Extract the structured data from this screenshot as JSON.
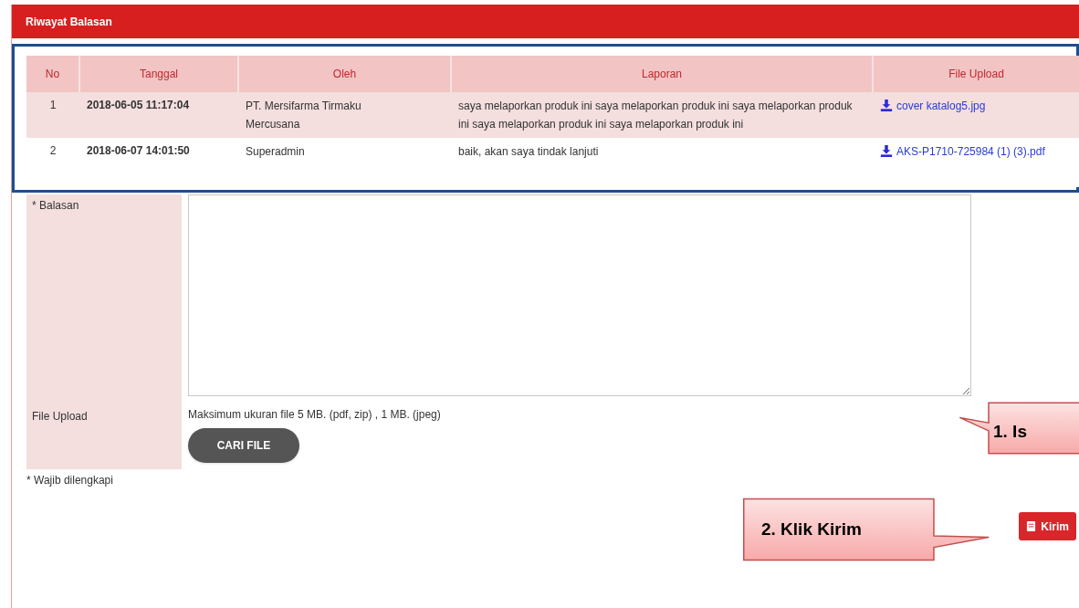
{
  "panel": {
    "title": "Riwayat Balasan"
  },
  "table": {
    "columns": [
      "No",
      "Tanggal",
      "Oleh",
      "Laporan",
      "File Upload"
    ],
    "rows": [
      {
        "no": "1",
        "tanggal": "2018-06-05 11:17:04",
        "oleh": "PT. Mersifarma Tirmaku Mercusana",
        "laporan": "saya melaporkan produk ini saya melaporkan produk ini saya melaporkan produk ini saya melaporkan produk ini saya melaporkan produk ini",
        "file": "cover katalog5.jpg"
      },
      {
        "no": "2",
        "tanggal": "2018-06-07 14:01:50",
        "oleh": "Superadmin",
        "laporan": "baik, akan saya tindak lanjuti",
        "file": "AKS-P1710-725984 (1) (3).pdf"
      }
    ]
  },
  "form": {
    "reply_label": "* Balasan",
    "upload_label": "File Upload",
    "upload_hint": "Maksimum ukuran file 5 MB. (pdf, zip) , 1 MB. (jpeg)",
    "browse_button": "CARI FILE",
    "required_note": "* Wajib dilengkapi",
    "submit_button": "Kirim"
  },
  "callouts": [
    {
      "text": "1. Is"
    },
    {
      "text": "2. Klik Kirim"
    }
  ]
}
